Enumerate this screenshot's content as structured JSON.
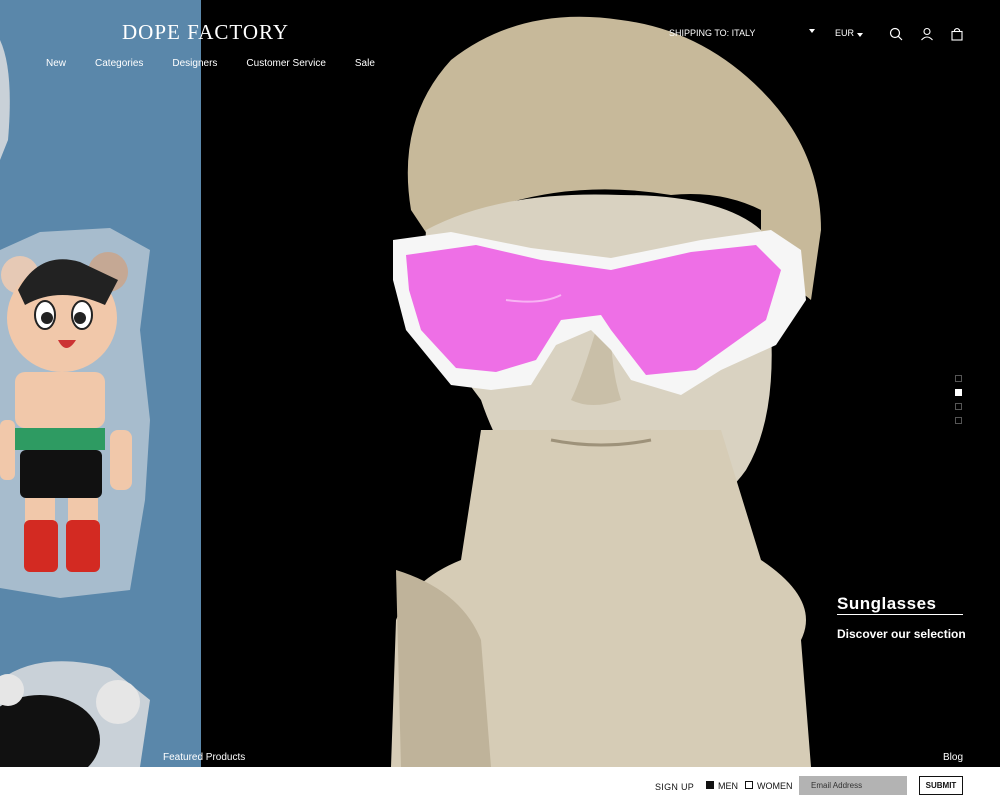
{
  "brand": {
    "logo": "DOPE FACTORY"
  },
  "nav": {
    "items": [
      "New",
      "Categories",
      "Designers",
      "Customer Service",
      "Sale"
    ]
  },
  "header": {
    "shipping": "SHIPPING TO: ITALY",
    "currency": "EUR"
  },
  "icons": {
    "search": "search-icon",
    "account": "user-icon",
    "cart": "bag-icon"
  },
  "slider": {
    "title": "Sunglasses",
    "subtitle": "Discover our selection",
    "pages": 4,
    "active_index": 1
  },
  "links": {
    "featured": "Featured Products",
    "blog": "Blog"
  },
  "newsletter": {
    "label": "SIGN UP",
    "men": "MEN",
    "women": "WOMEN",
    "men_checked": true,
    "women_checked": false,
    "placeholder": "Email Address",
    "submit": "SUBMIT"
  },
  "colors": {
    "left_panel": "#5a87aa",
    "hero_bg": "#000000",
    "lens": "#ee6fe6"
  }
}
